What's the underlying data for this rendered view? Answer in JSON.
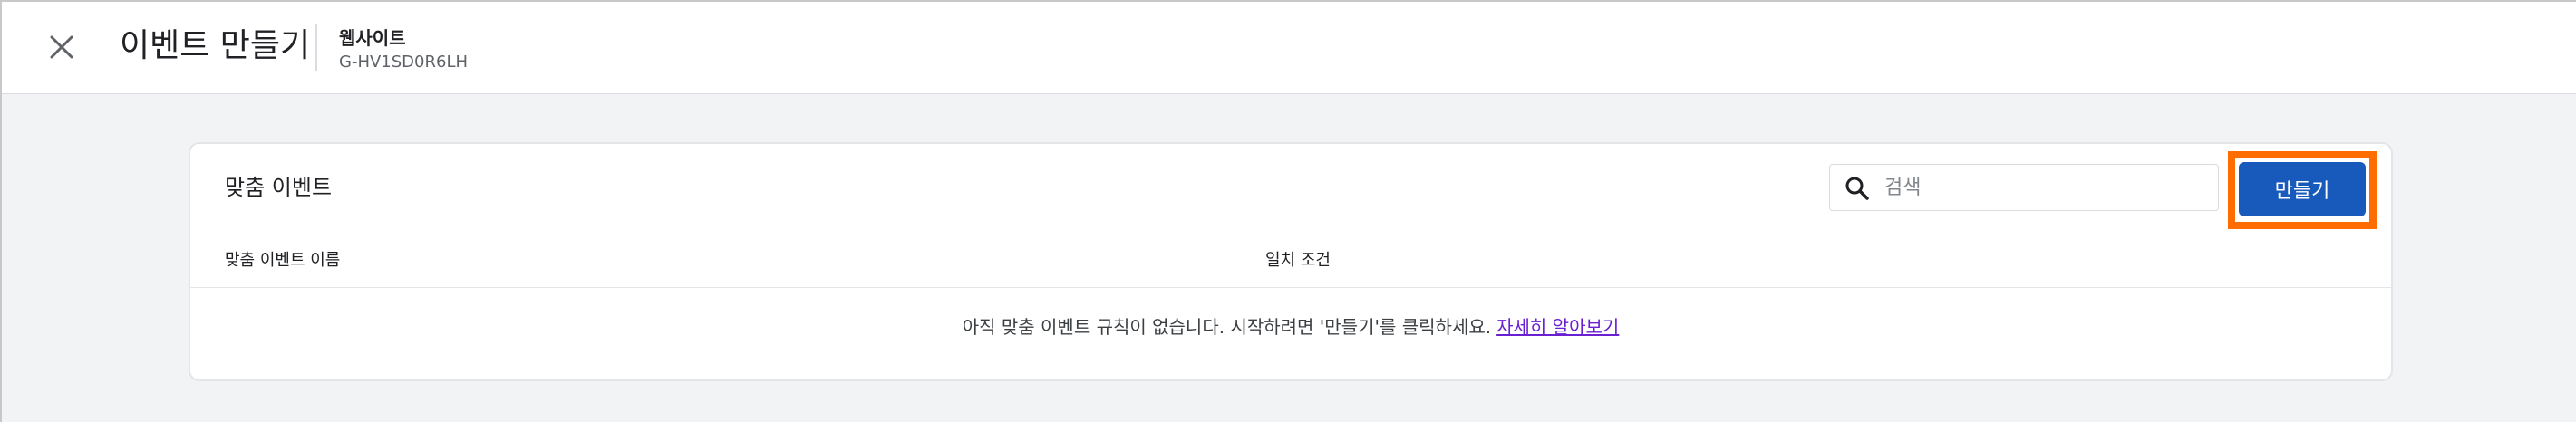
{
  "header": {
    "title": "이벤트 만들기",
    "property_name": "웹사이트",
    "property_id": "G-HV1SD0R6LH",
    "close_icon": "close-icon"
  },
  "card": {
    "title": "맞춤 이벤트",
    "search": {
      "placeholder": "검색",
      "value": "",
      "icon": "search-icon"
    },
    "create_label": "만들기",
    "columns": [
      "맞춤 이벤트 이름",
      "일치 조건"
    ],
    "empty_message": "아직 맞춤 이벤트 규칙이 없습니다. 시작하려면 '만들기'를 클릭하세요.",
    "learn_more": "자세히 알아보기"
  },
  "colors": {
    "primary": "#185abc",
    "highlight": "#ff6d00",
    "link": "#6a1fd1",
    "background": "#f1f3f4"
  }
}
